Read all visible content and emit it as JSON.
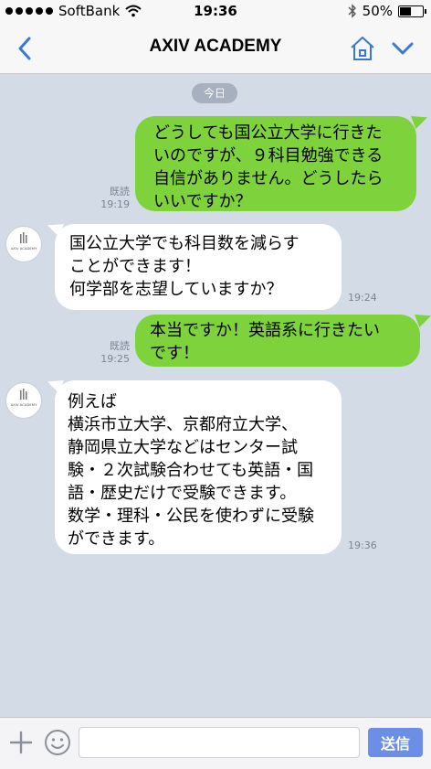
{
  "status_bar": {
    "carrier": "SoftBank",
    "time": "19:36",
    "battery": "50%",
    "battery_level": 0.5
  },
  "header": {
    "title": "AXIV ACADEMY",
    "back_icon": "chevron-left-icon",
    "home_icon": "home-icon",
    "menu_icon": "chevron-down-icon",
    "accent_color": "#3a78d8"
  },
  "chat": {
    "date_label": "今日",
    "avatar_text": "AXIV ACADEMY",
    "messages": [
      {
        "side": "out",
        "text": "どうしても国公立大学に行きた\nいのですが、９科目勉強できる\n自信がありません。どうしたら\nいいですか？",
        "read": "既読",
        "time": "19:19"
      },
      {
        "side": "in",
        "text": "国公立大学でも科目数を減らす\nことができます！\n何学部を志望していますか？",
        "time": "19:24"
      },
      {
        "side": "out",
        "text": "本当ですか！英語系に行きたい\nです！",
        "read": "既読",
        "time": "19:25"
      },
      {
        "side": "in",
        "text": "例えば\n横浜市立大学、京都府立大学、\n静岡県立大学などはセンター試\n験・２次試験合わせても英語・国\n語・歴史だけで受験できます。\n数学・理科・公民を使わずに受験\nができます。",
        "time": "19:36"
      }
    ]
  },
  "input_bar": {
    "placeholder": "",
    "send_label": "送信",
    "plus_icon": "plus-icon",
    "emoji_icon": "emoji-icon",
    "send_color": "#6b8ee6"
  },
  "colors": {
    "chat_bg": "#d3dbe6",
    "bubble_out": "#7ed33d",
    "bubble_in": "#ffffff"
  }
}
